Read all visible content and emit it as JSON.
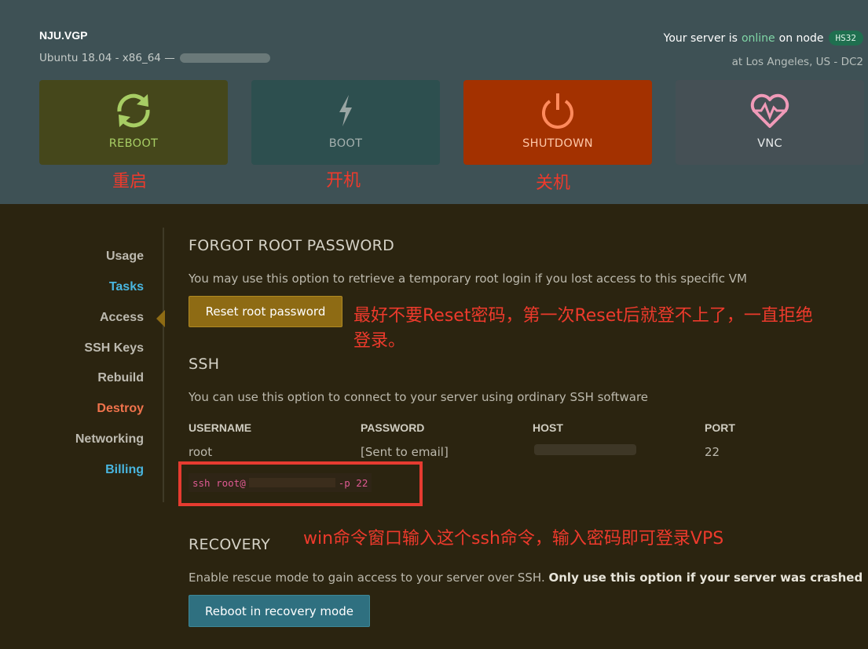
{
  "header": {
    "hostname": "NJU.VGP",
    "os": "Ubuntu 18.04 - x86_64 —",
    "status_prefix": "Your server is",
    "status_state": "online",
    "status_middle": "on node",
    "node_badge": "HS32",
    "location": "at Los Angeles, US - DC2"
  },
  "actions": {
    "reboot": {
      "label": "REBOOT",
      "icon": "refresh-icon",
      "note": "重启"
    },
    "boot": {
      "label": "BOOT",
      "icon": "lightning-icon",
      "note": "开机"
    },
    "shutdown": {
      "label": "SHUTDOWN",
      "icon": "power-icon",
      "note": "关机"
    },
    "vnc": {
      "label": "VNC",
      "icon": "heart-pulse-icon"
    }
  },
  "sidebar": {
    "items": [
      {
        "label": "Usage"
      },
      {
        "label": "Tasks"
      },
      {
        "label": "Access"
      },
      {
        "label": "SSH Keys"
      },
      {
        "label": "Rebuild"
      },
      {
        "label": "Destroy"
      },
      {
        "label": "Networking"
      },
      {
        "label": "Billing"
      }
    ],
    "active": "Access"
  },
  "forgot": {
    "title": "FORGOT ROOT PASSWORD",
    "desc": "You may use this option to retrieve a temporary root login if you lost access to this specific VM",
    "button": "Reset root password",
    "note_line1": "最好不要Reset密码，第一次Reset后就登不上了，一直拒绝",
    "note_line2": "登录。"
  },
  "ssh": {
    "title": "SSH",
    "desc": "You can use this option to connect to your server using ordinary SSH software",
    "columns": [
      "USERNAME",
      "PASSWORD",
      "HOST",
      "PORT"
    ],
    "username": "root",
    "password": "[Sent to email]",
    "port": "22",
    "cmd_prefix": "ssh root@",
    "cmd_suffix": "-p 22",
    "note": "win命令窗口输入这个ssh命令，输入密码即可登录VPS"
  },
  "recovery": {
    "title": "RECOVERY",
    "desc_normal": "Enable rescue mode to gain access to your server over SSH.",
    "desc_bold": "Only use this option if your server was crashed",
    "button": "Reboot in recovery mode"
  },
  "colors": {
    "header_bg": "#3e5155",
    "body_bg": "#2b2410",
    "accent_online": "#7fd6a6",
    "link_blue": "#49b6e0",
    "danger": "#f0734c",
    "annotation_red": "#ee3a2c"
  }
}
